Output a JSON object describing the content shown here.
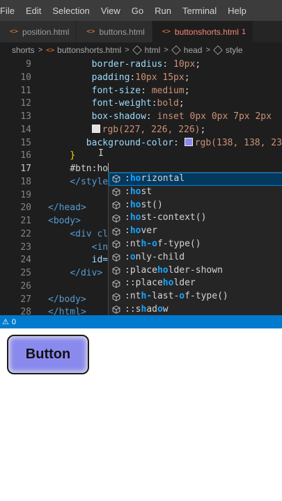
{
  "menubar": {
    "items": [
      "File",
      "Edit",
      "Selection",
      "View",
      "Go",
      "Run",
      "Terminal",
      "Help"
    ]
  },
  "tabs": [
    {
      "icon": "<>",
      "label": "position.html"
    },
    {
      "icon": "<>",
      "label": "buttons.html"
    },
    {
      "icon": "<>",
      "label": "buttonshorts.html",
      "modified_marker": "1"
    }
  ],
  "breadcrumb": {
    "folder": "shorts",
    "file": "buttonshorts.html",
    "html": "html",
    "head": "head",
    "style": "style",
    "separator": ">"
  },
  "editor": {
    "lines": [
      {
        "n": "9",
        "indent": "        ",
        "prop": "border-radius",
        "colon": ": ",
        "value": "10px",
        "end": ";"
      },
      {
        "n": "10",
        "indent": "        ",
        "prop": "padding",
        "colon": ":",
        "value": "10px 15px",
        "end": ";"
      },
      {
        "n": "11",
        "indent": "        ",
        "prop": "font-size",
        "colon": ": ",
        "value": "medium",
        "end": ";"
      },
      {
        "n": "12",
        "indent": "        ",
        "prop": "font-weight",
        "colon": ":",
        "value": "bold",
        "end": ";"
      },
      {
        "n": "13",
        "indent": "        ",
        "prop": "box-shadow",
        "colon": ": ",
        "value": "inset 0px 0px 7px 2px",
        "end": ""
      },
      {
        "n": "14",
        "indent": "        ",
        "swatch": "#e3e2e2",
        "value": "rgb(227, 226, 226)",
        "end": ";"
      },
      {
        "n": "15",
        "indent": "       ",
        "prop": "background-color",
        "colon": ": ",
        "swatch": "#8a8aee",
        "value": "rgb(138, 138, 23",
        "end": ""
      },
      {
        "n": "16",
        "indent": "    ",
        "brace": "}"
      },
      {
        "n": "17",
        "indent": "    ",
        "text": "#btn:ho",
        "current": true
      },
      {
        "n": "18",
        "indent": "    ",
        "tag": "</style"
      },
      {
        "n": "19",
        "indent": ""
      },
      {
        "n": "20",
        "indent": "",
        "tag": "</head>"
      },
      {
        "n": "21",
        "indent": "",
        "tag": "<body>"
      },
      {
        "n": "22",
        "indent": "    ",
        "tag": "<div cl"
      },
      {
        "n": "23",
        "indent": "        ",
        "tag": "<in"
      },
      {
        "n": "24",
        "indent": "        ",
        "prop": "id="
      },
      {
        "n": "25",
        "indent": "    ",
        "tag": "</div>"
      },
      {
        "n": "26",
        "indent": ""
      },
      {
        "n": "27",
        "indent": "",
        "tag": "</body>"
      },
      {
        "n": "28",
        "indent": "",
        "tag": "</html>"
      }
    ]
  },
  "suggestions": [
    {
      "pre": ":",
      "hl": "ho",
      "post": "rizontal",
      "selected": true
    },
    {
      "pre": ":",
      "hl": "ho",
      "post": "st"
    },
    {
      "pre": ":",
      "hl": "ho",
      "post": "st()"
    },
    {
      "pre": ":",
      "hl": "ho",
      "post": "st-context()"
    },
    {
      "pre": ":",
      "hl": "ho",
      "post": "ver"
    },
    {
      "pre": ":nt",
      "hl": "h-o",
      "post": "f-type()"
    },
    {
      "pre": ":",
      "hl": "o",
      "post": "nly-child"
    },
    {
      "pre": ":place",
      "hl": "ho",
      "post": "lder-shown"
    },
    {
      "pre": "::place",
      "hl": "ho",
      "post": "lder"
    },
    {
      "pre": ":nt",
      "hl": "h-",
      "post": "last-",
      "hl2": "o",
      "post2": "f-type()"
    },
    {
      "pre": "::s",
      "hl": "h",
      "post": "ad",
      "hl2": "o",
      "post2": "w"
    }
  ],
  "statusbar": {
    "warning_icon": "⚠",
    "problems": "0"
  },
  "preview": {
    "button_label": "Button"
  }
}
